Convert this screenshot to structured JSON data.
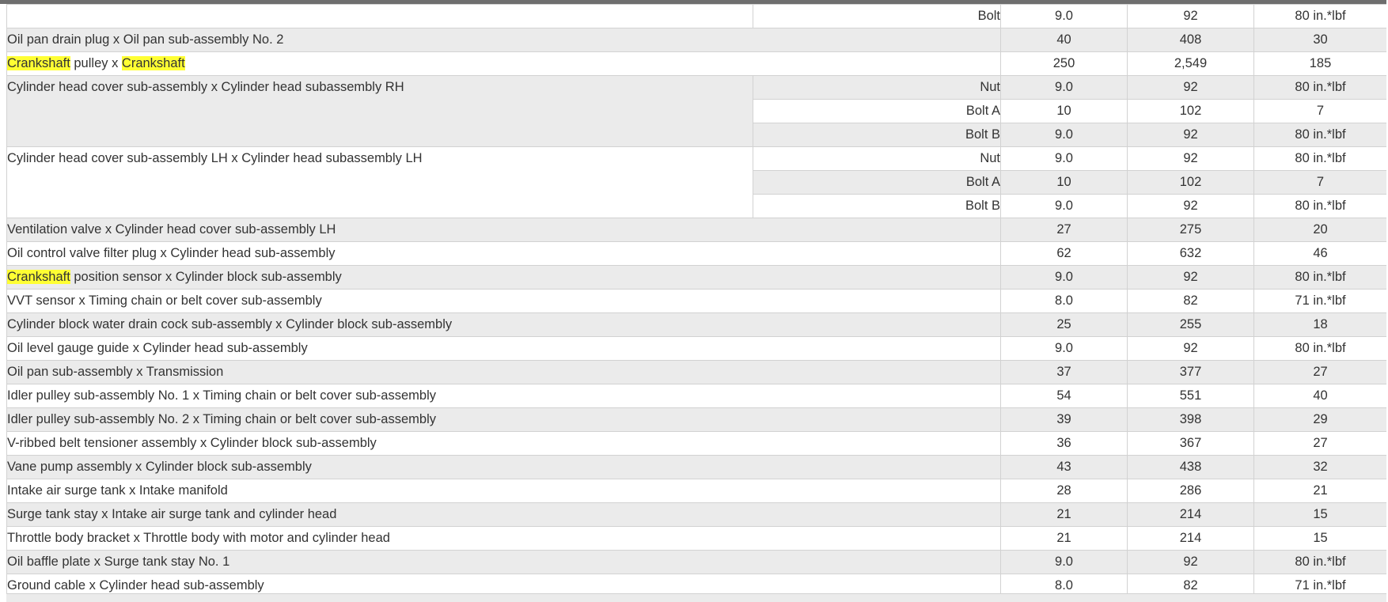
{
  "table": {
    "rows": [
      {
        "part": "",
        "fastener": "Bolt",
        "nm": "9.0",
        "kgfcm": "92",
        "ftlbf": "80 in.*lbf"
      },
      {
        "part": "Oil pan drain plug x Oil pan sub-assembly No. 2",
        "nm": "40",
        "kgfcm": "408",
        "ftlbf": "30"
      },
      {
        "part_a": "Crankshaft",
        "part_b": " pulley x ",
        "part_c": "Crankshaft",
        "nm": "250",
        "kgfcm": "2,549",
        "ftlbf": "185"
      },
      {
        "part": "Cylinder head cover sub-assembly x Cylinder head subassembly RH",
        "fastener": "Nut",
        "nm": "9.0",
        "kgfcm": "92",
        "ftlbf": "80 in.*lbf"
      },
      {
        "fastener": "Bolt A",
        "nm": "10",
        "kgfcm": "102",
        "ftlbf": "7"
      },
      {
        "fastener": "Bolt B",
        "nm": "9.0",
        "kgfcm": "92",
        "ftlbf": "80 in.*lbf"
      },
      {
        "part": "Cylinder head cover sub-assembly LH x Cylinder head subassembly LH",
        "fastener": "Nut",
        "nm": "9.0",
        "kgfcm": "92",
        "ftlbf": "80 in.*lbf"
      },
      {
        "fastener": "Bolt A",
        "nm": "10",
        "kgfcm": "102",
        "ftlbf": "7"
      },
      {
        "fastener": "Bolt B",
        "nm": "9.0",
        "kgfcm": "92",
        "ftlbf": "80 in.*lbf"
      },
      {
        "part": "Ventilation valve x Cylinder head cover sub-assembly LH",
        "nm": "27",
        "kgfcm": "275",
        "ftlbf": "20"
      },
      {
        "part": "Oil control valve filter plug x Cylinder head sub-assembly",
        "nm": "62",
        "kgfcm": "632",
        "ftlbf": "46"
      },
      {
        "part_a": "Crankshaft",
        "part_b": " position sensor x Cylinder block sub-assembly",
        "nm": "9.0",
        "kgfcm": "92",
        "ftlbf": "80 in.*lbf"
      },
      {
        "part": "VVT sensor x Timing chain or belt cover sub-assembly",
        "nm": "8.0",
        "kgfcm": "82",
        "ftlbf": "71 in.*lbf"
      },
      {
        "part": "Cylinder block water drain cock sub-assembly x Cylinder block sub-assembly",
        "nm": "25",
        "kgfcm": "255",
        "ftlbf": "18"
      },
      {
        "part": "Oil level gauge guide x Cylinder head sub-assembly",
        "nm": "9.0",
        "kgfcm": "92",
        "ftlbf": "80 in.*lbf"
      },
      {
        "part": "Oil pan sub-assembly x Transmission",
        "nm": "37",
        "kgfcm": "377",
        "ftlbf": "27"
      },
      {
        "part": "Idler pulley sub-assembly No. 1 x Timing chain or belt cover sub-assembly",
        "nm": "54",
        "kgfcm": "551",
        "ftlbf": "40"
      },
      {
        "part": "Idler pulley sub-assembly No. 2 x Timing chain or belt cover sub-assembly",
        "nm": "39",
        "kgfcm": "398",
        "ftlbf": "29"
      },
      {
        "part": "V-ribbed belt tensioner assembly x Cylinder block sub-assembly",
        "nm": "36",
        "kgfcm": "367",
        "ftlbf": "27"
      },
      {
        "part": "Vane pump assembly x Cylinder block sub-assembly",
        "nm": "43",
        "kgfcm": "438",
        "ftlbf": "32"
      },
      {
        "part": "Intake air surge tank x Intake manifold",
        "nm": "28",
        "kgfcm": "286",
        "ftlbf": "21"
      },
      {
        "part": "Surge tank stay x Intake air surge tank and cylinder head",
        "nm": "21",
        "kgfcm": "214",
        "ftlbf": "15"
      },
      {
        "part": "Throttle body bracket x Throttle body with motor and cylinder head",
        "nm": "21",
        "kgfcm": "214",
        "ftlbf": "15"
      },
      {
        "part": "Oil baffle plate x Surge tank stay No. 1",
        "nm": "9.0",
        "kgfcm": "92",
        "ftlbf": "80 in.*lbf"
      },
      {
        "part": "Ground cable x Cylinder head sub-assembly",
        "nm": "8.0",
        "kgfcm": "82",
        "ftlbf": "71 in.*lbf"
      }
    ]
  }
}
